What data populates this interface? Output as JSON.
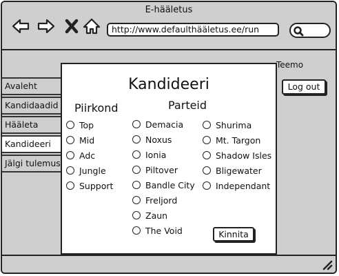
{
  "window": {
    "title": "E-hääletus"
  },
  "browser": {
    "url": "http://www.defaulthääletus.ee/run",
    "icons": [
      "back-arrow-icon",
      "forward-arrow-icon",
      "close-icon",
      "home-icon",
      "search-icon"
    ]
  },
  "header": {
    "username": "Teemo",
    "logout_label": "Log out"
  },
  "tabs": [
    {
      "label": "Avaleht",
      "active": false
    },
    {
      "label": "Kandidaadid",
      "active": false
    },
    {
      "label": "Hääleta",
      "active": false
    },
    {
      "label": "Kandideeri",
      "active": true
    },
    {
      "label": "Jälgi tulemusi",
      "active": false
    }
  ],
  "form": {
    "title": "Kandideeri",
    "district_heading": "Piirkond",
    "party_heading": "Parteid",
    "districts": [
      "Top",
      "Mid",
      "Adc",
      "Jungle",
      "Support"
    ],
    "parties_col1": [
      "Demacia",
      "Noxus",
      "Ionia",
      "Piltover",
      "Bandle City",
      "Freljord",
      "Zaun",
      "The Void"
    ],
    "parties_col2": [
      "Shurima",
      "Mt. Targon",
      "Shadow Isles",
      "Bligewater",
      "Independant"
    ],
    "confirm_label": "Kinnita"
  }
}
